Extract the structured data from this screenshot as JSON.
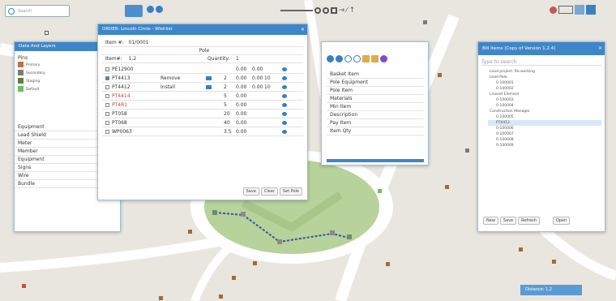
{
  "topbar": {
    "search_label": "Search",
    "tools": [
      "undo-icon",
      "circle-icon",
      "box-icon",
      "arrow-icon",
      "line-icon",
      "pin-icon"
    ]
  },
  "left_panel": {
    "title": "Data And Layers",
    "section": "Pins",
    "legend": [
      {
        "label": "Primary",
        "color": "#c0714a"
      },
      {
        "label": "Secondary",
        "color": "#7b7b7b"
      },
      {
        "label": "Staging",
        "color": "#5f7f3b"
      },
      {
        "label": "Default",
        "color": "#6cbf5a"
      }
    ],
    "items": [
      "Equipment",
      "Lead Shield",
      "Meter",
      "Member",
      "Equipment",
      "Signs",
      "Wire",
      "Bundle"
    ]
  },
  "order_dialog": {
    "title": "ORDER: Lincoln Circle - Wishlist",
    "item_label": "Item #:",
    "item_value": "01/0001",
    "pole_label": "Pole",
    "rows_label": "Item#:",
    "rows_value": "1.2",
    "qty_label": "Quantity:",
    "qty_value": "1",
    "rows": [
      {
        "code": "PE12900",
        "action": "",
        "qty": "",
        "price": "0.00",
        "extra": "0.00",
        "n": "",
        "red": false
      },
      {
        "code": "PT4413",
        "action": "Remove",
        "qty": "2",
        "price": "0.00",
        "extra": "0.00",
        "n": "10",
        "red": false
      },
      {
        "code": "PT4412",
        "action": "Install",
        "qty": "2",
        "price": "0.00",
        "extra": "0.00",
        "n": "10",
        "red": false
      },
      {
        "code": "PT4414",
        "action": "",
        "qty": "5",
        "price": "0.00",
        "extra": "",
        "n": "",
        "red": true
      },
      {
        "code": "PT4R1",
        "action": "",
        "qty": "5",
        "price": "0.00",
        "extra": "",
        "n": "",
        "red": true
      },
      {
        "code": "PT058",
        "action": "",
        "qty": "20",
        "price": "0.00",
        "extra": "",
        "n": "",
        "red": false
      },
      {
        "code": "PT068",
        "action": "",
        "qty": "40",
        "price": "0.00",
        "extra": "",
        "n": "",
        "red": false
      },
      {
        "code": "WP0063",
        "action": "",
        "qty": "3.5",
        "price": "0.00",
        "extra": "",
        "n": "",
        "red": false
      }
    ],
    "buttons": [
      "Save",
      "Clear",
      "Set Pole"
    ]
  },
  "mid_panel": {
    "items": [
      "Basket Item",
      "Pole Equipment",
      "Pole Item",
      "Materials",
      "Min Item",
      "Description",
      "Pay Item",
      "Item Qty"
    ]
  },
  "right_panel": {
    "title": "Bill Items (Copy of Version 1.2.4)",
    "search": "Type to search",
    "tree": [
      "Lead project: Re-working",
      "Lead Pole",
      "0-100001",
      "0-100002",
      "Lineset Element",
      "0-100003",
      "0-100004",
      "Construction Manager",
      "0-100005",
      "PT4413",
      "0-100006",
      "0-100007",
      "0-100008",
      "0-100009"
    ],
    "buttons": [
      "New",
      "Save",
      "Refresh",
      "Open"
    ]
  },
  "zoom_label": "Distance: 1.2",
  "colors": {
    "accent": "#3f86c8",
    "route": "#3b4fa8",
    "park": "#b7d29a"
  }
}
